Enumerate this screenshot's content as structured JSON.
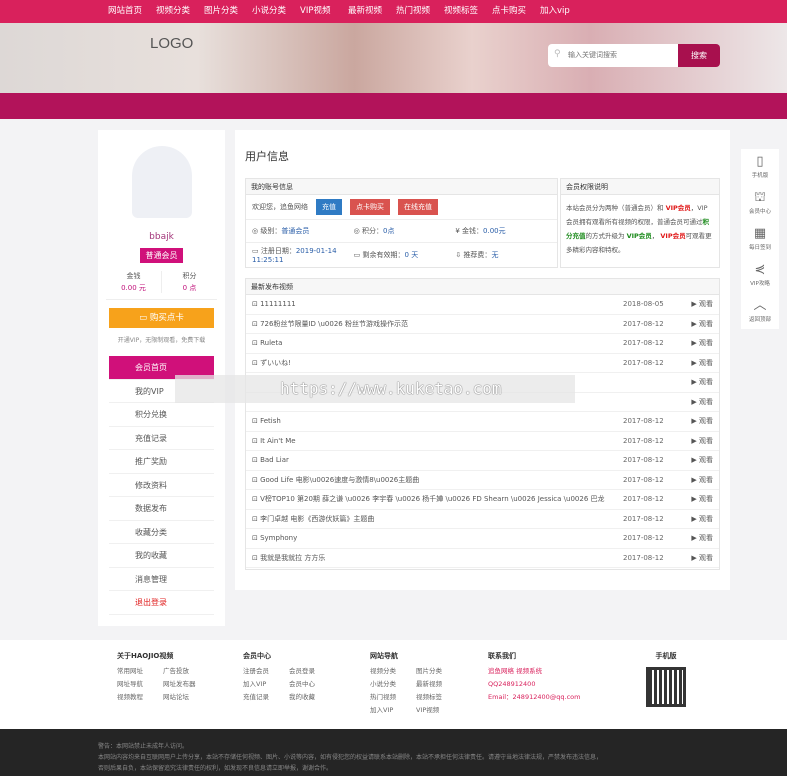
{
  "nav": [
    "网站首页",
    "视频分类",
    "图片分类",
    "小说分类",
    "VIP视频",
    "最新视频",
    "热门视频",
    "视频标签",
    "点卡购买",
    "加入vip"
  ],
  "header": {
    "logo": "LOGO",
    "search_placeholder": "输入关键词搜索",
    "search_button": "搜索"
  },
  "profile": {
    "username": "bbajk",
    "level_badge": "普通会员",
    "balance_label": "金钱",
    "balance": "0.00 元",
    "points_label": "积分",
    "points": "0 点",
    "buy_card": "购买点卡",
    "tip": "开通VIP，无限制观看，免费下载"
  },
  "menu": [
    "会员首页",
    "我的VIP",
    "积分兑换",
    "充值记录",
    "推广奖励",
    "修改资料",
    "数据发布",
    "收藏分类",
    "我的收藏",
    "消息管理",
    "退出登录"
  ],
  "main": {
    "title": "用户信息",
    "account": {
      "header": "我的账号信息",
      "welcome": "欢迎您，追鱼网络",
      "btn_recharge": "充值",
      "btn_card": "点卡购买",
      "btn_online": "在线充值",
      "group_label": "级别：",
      "group": "普通会员",
      "points_label": "积分：",
      "points": "0点",
      "money_label": "金钱：",
      "money": "0.00元",
      "reg_label": "注册日期：",
      "reg": "2019-01-14 11:25:11",
      "expire_label": "剩余有效期：",
      "expire": "0 天",
      "promo_label": "推荐费：",
      "promo": "无"
    },
    "rights": {
      "header": "会员权限说明",
      "p1": "本站会员分为两种（普通会员）和",
      "vip1": "VIP会员",
      "p2": "，VIP会员拥有观看所有视频的权限，普通会员可通过",
      "g1": "积分充值",
      "p3": "的方式升级为",
      "g2": "VIP会员",
      "p4": "，",
      "vip2": "VIP会员",
      "p5": "可观看更多精彩内容和特权。"
    },
    "recent": {
      "header": "最新发布视频",
      "items": [
        {
          "title": "11111111",
          "date": "2018-08-05",
          "action": "▶ 观看"
        },
        {
          "title": "726粉丝节限量ID \\u0026 粉丝节游戏操作示范",
          "date": "2017-08-12",
          "action": "▶ 观看"
        },
        {
          "title": "Ruleta",
          "date": "2017-08-12",
          "action": "▶ 观看"
        },
        {
          "title": "ずいいね!",
          "date": "2017-08-12",
          "action": "▶ 观看"
        },
        {
          "title": "",
          "date": "",
          "action": "▶ 观看"
        },
        {
          "title": "",
          "date": "",
          "action": "▶ 观看"
        },
        {
          "title": "Fetish",
          "date": "2017-08-12",
          "action": "▶ 观看"
        },
        {
          "title": "It Ain't Me",
          "date": "2017-08-12",
          "action": "▶ 观看"
        },
        {
          "title": "Bad Liar",
          "date": "2017-08-12",
          "action": "▶ 观看"
        },
        {
          "title": "Good Life 电影\\u0026速度与激情8\\u0026主题曲",
          "date": "2017-08-12",
          "action": "▶ 观看"
        },
        {
          "title": "V榜TOP10 第20期 薛之谦 \\u0026 李宇春 \\u0026 杨千嬅 \\u0026 FD Shearn \\u0026 Jessica \\u0026 巴龙",
          "date": "2017-08-12",
          "action": "▶ 观看"
        },
        {
          "title": "李门卓越 电影《西游伏妖篇》主题曲",
          "date": "2017-08-12",
          "action": "▶ 观看"
        },
        {
          "title": "Symphony",
          "date": "2017-08-12",
          "action": "▶ 观看"
        },
        {
          "title": "我就是我就拉 方方乐",
          "date": "2017-08-12",
          "action": "▶ 观看"
        }
      ]
    }
  },
  "float": [
    "手机版",
    "会员中心",
    "每日签到",
    "VIP攻略",
    "返回顶部"
  ],
  "footer": {
    "c1": {
      "title": "关于HAOJIO视频",
      "links": [
        "常用网址",
        "广告投放",
        "网址导航",
        "网址发布器",
        "视频教程",
        "网站论坛"
      ]
    },
    "c2": {
      "title": "会员中心",
      "links": [
        "注册会员",
        "会员登录",
        "加入VIP",
        "会员中心",
        "充值记录",
        "我的收藏"
      ]
    },
    "c3": {
      "title": "网站导航",
      "links": [
        "视频分类",
        "图片分类",
        "小说分类",
        "最新视频",
        "热门视频",
        "视频标签",
        "加入VIP",
        "VIP视频"
      ]
    },
    "c4": {
      "title": "联系我们",
      "company": "追鱼网络 视频系统",
      "qq": "QQ248912400",
      "email": "Email：248912400@qq.com"
    },
    "c5": {
      "title": "手机版"
    },
    "notice1": "警告：本网站禁止未成年人访问。",
    "notice2": "本网站内容均来自互联网用户上传分享，本站不存储任何视频、图片、小说等内容，如有侵犯您的权益请联系本站删除，本站不承担任何法律责任。请遵守当地法律法规，严禁发布违法信息，",
    "notice3": "否则后果自负，本站保留追究法律责任的权利，如发现不良信息请立即举报，谢谢合作。"
  },
  "watermark": "https://www.kuketao.com"
}
